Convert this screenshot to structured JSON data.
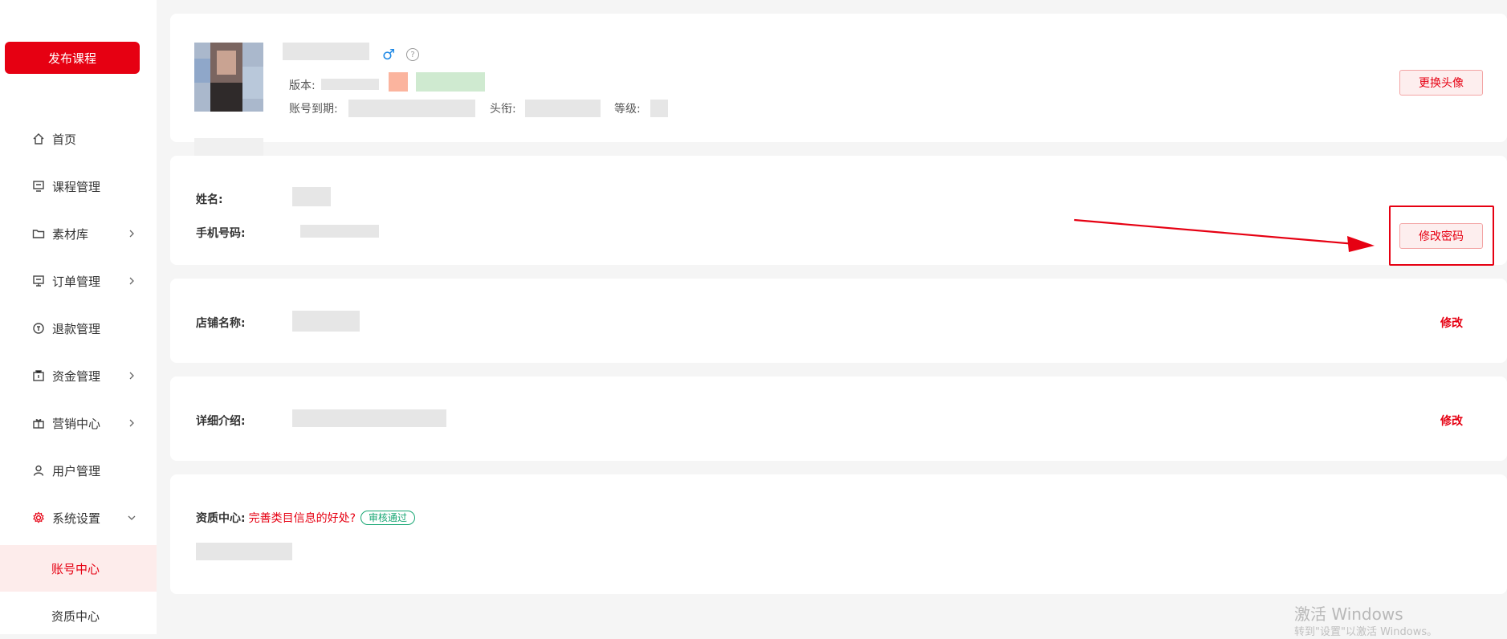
{
  "sidebar": {
    "publish_label": "发布课程",
    "items": [
      {
        "label": "首页",
        "icon": "home-icon"
      },
      {
        "label": "课程管理",
        "icon": "course-icon"
      },
      {
        "label": "素材库",
        "icon": "folder-icon"
      },
      {
        "label": "订单管理",
        "icon": "order-icon"
      },
      {
        "label": "退款管理",
        "icon": "refund-icon"
      },
      {
        "label": "资金管理",
        "icon": "wallet-icon"
      },
      {
        "label": "营销中心",
        "icon": "gift-icon"
      },
      {
        "label": "用户管理",
        "icon": "user-icon"
      },
      {
        "label": "系统设置",
        "icon": "settings-icon"
      },
      {
        "label": "账号中心"
      },
      {
        "label": "资质中心"
      }
    ]
  },
  "profile": {
    "gender_symbol": "♂",
    "help_symbol": "?",
    "version_label": "版本:",
    "expire_label": "账号到期:",
    "title_label": "头衔:",
    "level_label": "等级:",
    "change_avatar_label": "更换头像"
  },
  "account": {
    "name_label": "姓名:",
    "phone_label": "手机号码:",
    "change_password_label": "修改密码"
  },
  "shop": {
    "shop_name_label": "店铺名称:",
    "edit_label": "修改"
  },
  "detail": {
    "detail_label": "详细介绍:",
    "edit_label": "修改"
  },
  "qualification": {
    "label": "资质中心:",
    "link_text": "完善类目信息的好处?",
    "badge": "审核通过"
  },
  "watermark": {
    "line1": "激活 Windows",
    "line2": "转到\"设置\"以激活 Windows。"
  },
  "colors": {
    "brand": "#e60012",
    "badge": "#17a673",
    "gender": "#1e88e5"
  }
}
